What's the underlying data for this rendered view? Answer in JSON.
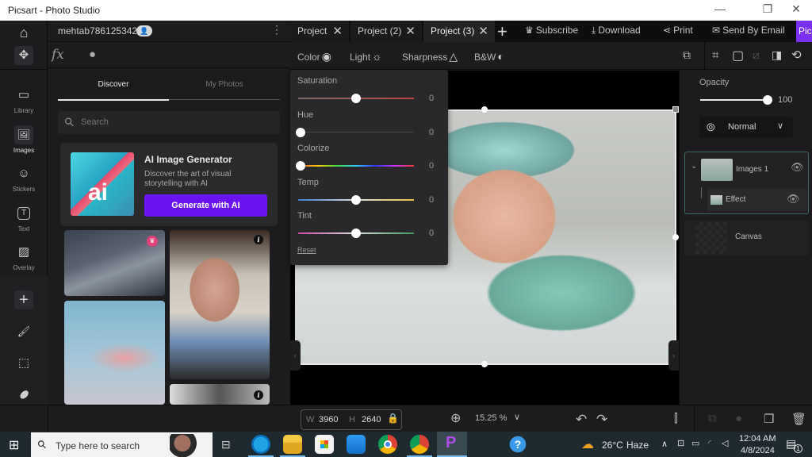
{
  "window": {
    "title": "Picsart - Photo Studio",
    "controls": {
      "minimize": "—",
      "maximize": "❐",
      "close": "✕"
    }
  },
  "rail": {
    "home_icon": "⌂",
    "move_icon": "✥",
    "items": [
      {
        "id": "library",
        "label": "Library",
        "icon": "▭"
      },
      {
        "id": "images",
        "label": "Images",
        "icon": "🖼"
      },
      {
        "id": "stickers",
        "label": "Stickers",
        "icon": "☺"
      },
      {
        "id": "text",
        "label": "Text",
        "icon": "T"
      },
      {
        "id": "overlay",
        "label": "Overlay",
        "icon": "▨"
      }
    ],
    "tools": [
      {
        "id": "add",
        "icon": "+"
      },
      {
        "id": "brush",
        "icon": "🖌"
      },
      {
        "id": "select",
        "icon": "⬚"
      },
      {
        "id": "eraser",
        "icon": "⬮"
      }
    ]
  },
  "panel": {
    "username": "mehtab786125342",
    "avatar_icon": "👤",
    "menu_icon": "⋮",
    "fx_label": "fx",
    "effects_icon": "●",
    "tabs": [
      {
        "label": "Discover",
        "active": true
      },
      {
        "label": "My Photos",
        "active": false
      }
    ],
    "search_placeholder": "Search",
    "search_icon": "⚲",
    "ai_card": {
      "title": "AI Image Generator",
      "description": "Discover the art of visual storytelling with AI",
      "button": "Generate with AI",
      "thumb_text": "ai"
    },
    "info_badge": "i",
    "premium_badge": "♛"
  },
  "project_tabs": [
    {
      "label": "Project",
      "active": false
    },
    {
      "label": "Project (2)",
      "active": false
    },
    {
      "label": "Project (3)",
      "active": true
    }
  ],
  "new_tab_icon": "+",
  "close_tab_icon": "✕",
  "top_actions": [
    {
      "id": "subscribe",
      "label": "Subscribe",
      "icon": "♛"
    },
    {
      "id": "download",
      "label": "Download",
      "icon": "⤓"
    },
    {
      "id": "print",
      "label": "Print",
      "icon": "⋖"
    },
    {
      "id": "email",
      "label": "Send By Email",
      "icon": "✉"
    }
  ],
  "picsart_button": "Pics",
  "adjust_tools": [
    {
      "id": "color",
      "label": "Color",
      "icon": "◉"
    },
    {
      "id": "light",
      "label": "Light",
      "icon": "☼"
    },
    {
      "id": "sharpness",
      "label": "Sharpness",
      "icon": "△"
    },
    {
      "id": "bw",
      "label": "B&W",
      "icon": "◐"
    }
  ],
  "color_panel": {
    "sliders": [
      {
        "label": "Saturation",
        "value": "0",
        "position": 0.5
      },
      {
        "label": "Hue",
        "value": "0",
        "position": 0.0
      },
      {
        "label": "Colorize",
        "value": "0",
        "position": 0.0
      },
      {
        "label": "Temp",
        "value": "0",
        "position": 0.5
      },
      {
        "label": "Tint",
        "value": "0",
        "position": 0.5
      }
    ],
    "reset_label": "Reset"
  },
  "right_panel": {
    "opacity_label": "Opacity",
    "opacity_value": "100",
    "opacity_fraction": 1.0,
    "blend_mode": "Normal",
    "blend_icon": "⊚",
    "layers": [
      {
        "name": "Images 1",
        "visible": true
      },
      {
        "name": "Effect",
        "visible": true
      },
      {
        "name": "Canvas"
      }
    ],
    "eye_icon": "👁",
    "collapse_icon": "⌄"
  },
  "bottom_bar": {
    "width_label": "W",
    "width_value": "3960",
    "height_label": "H",
    "height_value": "2640",
    "lock_icon": "🔒",
    "zoom_icon": "⊕",
    "zoom_value": "15.25 %",
    "undo_icon": "↶",
    "redo_icon": "↷"
  },
  "taskbar": {
    "search_placeholder": "Type here to search",
    "weather_temp": "26°C",
    "weather_desc": "Haze",
    "time": "12:04 AM",
    "date": "4/8/2024",
    "notification_count": "1"
  }
}
